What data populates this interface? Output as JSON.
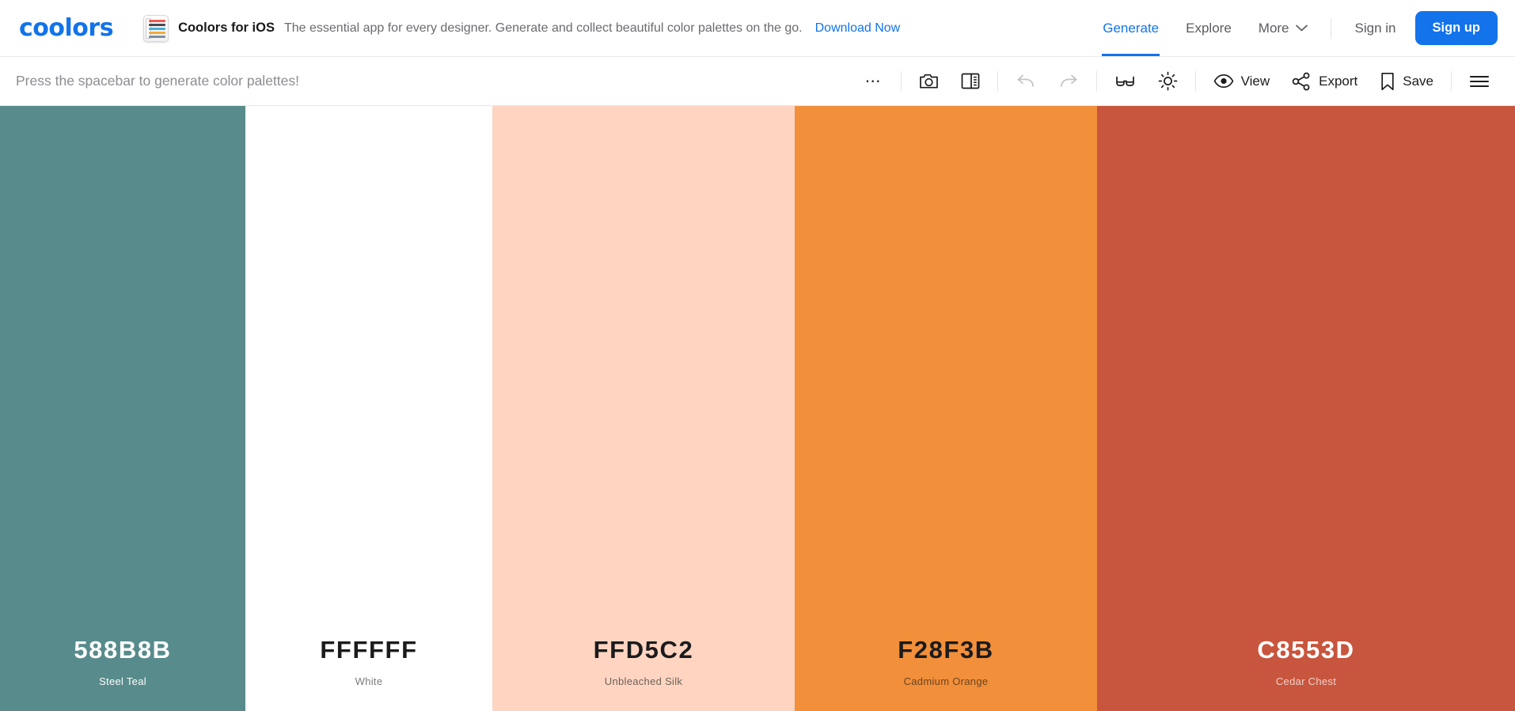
{
  "header": {
    "logo": "coolors",
    "promo": {
      "icon": "ios-app-icon",
      "title": "Coolors for iOS",
      "subtitle": "The essential app for every designer. Generate and collect beautiful color palettes on the go.",
      "link": "Download Now"
    },
    "nav": [
      {
        "label": "Generate",
        "active": true
      },
      {
        "label": "Explore",
        "active": false
      },
      {
        "label": "More",
        "active": false,
        "caret": "⌄"
      }
    ],
    "sign_in": "Sign in",
    "sign_up": "Sign up",
    "accent_color": "#1273EB"
  },
  "toolbar": {
    "hint": "Press the spacebar to generate color palettes!",
    "tools": [
      {
        "name": "more-options",
        "icon": "ellipsis-icon",
        "label": ""
      },
      {
        "name": "camera",
        "icon": "camera-icon",
        "label": ""
      },
      {
        "name": "layout",
        "icon": "layout-panel-icon",
        "label": ""
      },
      {
        "name": "undo",
        "icon": "undo-icon",
        "label": "",
        "disabled": true
      },
      {
        "name": "redo",
        "icon": "redo-icon",
        "label": "",
        "disabled": true
      },
      {
        "name": "colorblind",
        "icon": "glasses-icon",
        "label": ""
      },
      {
        "name": "adjust",
        "icon": "brightness-icon",
        "label": ""
      },
      {
        "name": "view",
        "icon": "eye-icon",
        "label": "View"
      },
      {
        "name": "export",
        "icon": "share-icon",
        "label": "Export"
      },
      {
        "name": "save",
        "icon": "bookmark-icon",
        "label": "Save"
      },
      {
        "name": "menu",
        "icon": "hamburger-icon",
        "label": ""
      }
    ]
  },
  "palette": {
    "swatches": [
      {
        "hex": "588B8B",
        "color": "#588B8B",
        "name": "Steel Teal",
        "text_color": "#FFFFFF",
        "width_pct": 16.3
      },
      {
        "hex": "FFFFFF",
        "color": "#FFFFFF",
        "name": "White",
        "text_color": "#1B1B1D",
        "width_pct": 16.3
      },
      {
        "hex": "FFD5C2",
        "color": "#FFD5C2",
        "name": "Unbleached Silk",
        "text_color": "#1B1B1D",
        "width_pct": 16.3
      },
      {
        "hex": "F28F3B",
        "color": "#F28F3B",
        "name": "Cadmium Orange",
        "text_color": "#1B1B1D",
        "width_pct": 16.3
      },
      {
        "hex": "C8553D",
        "color": "#C8553D",
        "name": "Cedar Chest",
        "text_color": "#FFFFFF",
        "width_pct": 16.3
      }
    ]
  }
}
